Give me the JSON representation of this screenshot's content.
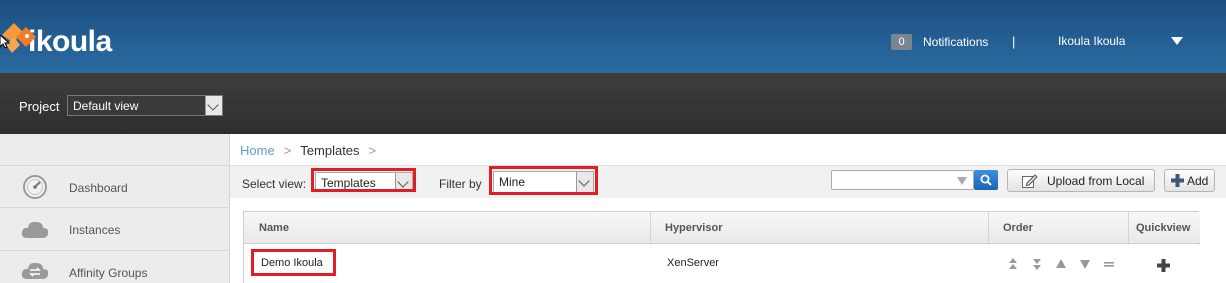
{
  "header": {
    "logo_text": "ikoula",
    "notifications_count": "0",
    "notifications_label": "Notifications",
    "separator": "|",
    "user_name": "Ikoula Ikoula"
  },
  "project": {
    "label": "Project",
    "selected": "Default view"
  },
  "sidebar": {
    "items": [
      {
        "label": "Dashboard",
        "icon": "dashboard-gauge-icon"
      },
      {
        "label": "Instances",
        "icon": "cloud-icon"
      },
      {
        "label": "Affinity Groups",
        "icon": "affinity-groups-icon"
      }
    ]
  },
  "breadcrumb": {
    "home": "Home",
    "arrow": ">",
    "current": "Templates"
  },
  "toolbar": {
    "select_view_label": "Select view:",
    "select_view_value": "Templates",
    "filter_label": "Filter by",
    "filter_value": "Mine",
    "search_placeholder": "",
    "upload_label": "Upload from Local",
    "add_label": "Add",
    "highlight_color": "#e01e26"
  },
  "table": {
    "columns": [
      "Name",
      "Hypervisor",
      "Order",
      "Quickview"
    ],
    "rows": [
      {
        "name": "Demo Ikoula",
        "hypervisor": "XenServer"
      }
    ]
  }
}
